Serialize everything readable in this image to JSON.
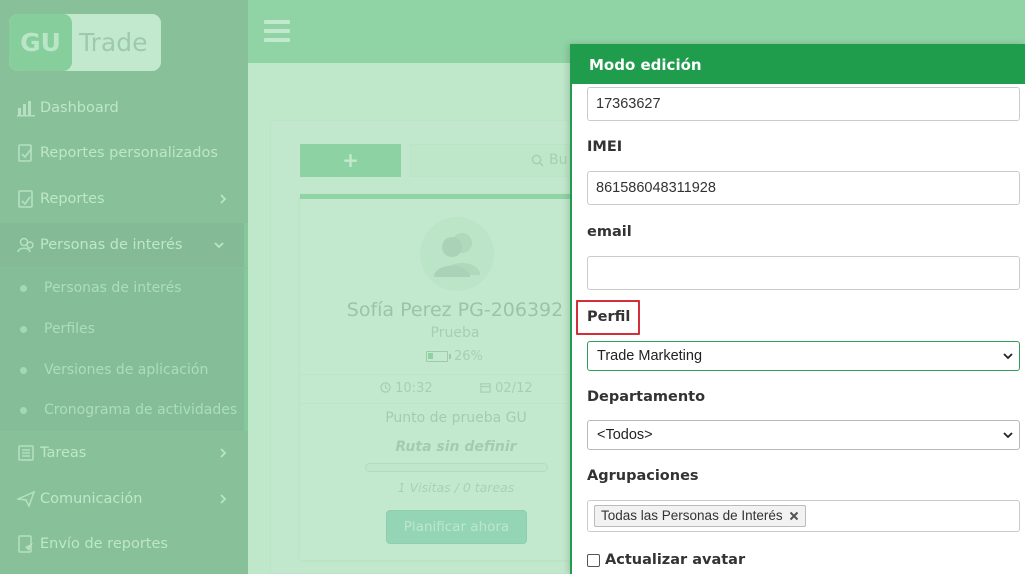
{
  "app": {
    "logo_mark": "GU",
    "logo_text": "Trade"
  },
  "sidebar": {
    "items": [
      {
        "label": "Dashboard",
        "icon": "chart-bars-icon"
      },
      {
        "label": "Reportes personalizados",
        "icon": "report-edit-icon"
      },
      {
        "label": "Reportes",
        "icon": "report-icon"
      },
      {
        "label": "Personas de interés",
        "icon": "people-icon"
      },
      {
        "label": "Tareas",
        "icon": "tasks-icon"
      },
      {
        "label": "Comunicación",
        "icon": "paper-plane-icon"
      },
      {
        "label": "Envío de reportes",
        "icon": "send-report-icon"
      }
    ],
    "submenu": [
      {
        "label": "Personas de interés"
      },
      {
        "label": "Perfiles"
      },
      {
        "label": "Versiones de aplicación"
      },
      {
        "label": "Cronograma de actividades"
      }
    ]
  },
  "main": {
    "add_label": "+",
    "search_placeholder": "Bu",
    "card": {
      "name": "Sofía Perez PG-206392",
      "subtitle": "Prueba",
      "battery": "26%",
      "battery_level": 0.26,
      "time": "10:32",
      "date": "02/12",
      "point": "Punto de prueba GU",
      "route": "Ruta sin definir",
      "route_progress": 0,
      "visits": "1 Visitas  /  0 tareas",
      "plan_button": "Planificar ahora"
    }
  },
  "modal": {
    "title": "Modo edición",
    "fields": {
      "phone_value": "17363627",
      "imei_label": "IMEI",
      "imei_value": "861586048311928",
      "email_label": "email",
      "email_value": "",
      "perfil_label": "Perfil",
      "perfil_value": "Trade Marketing",
      "departamento_label": "Departamento",
      "departamento_value": "<Todos>",
      "agrupaciones_label": "Agrupaciones",
      "agrupaciones_tag": "Todas las Personas de Interés",
      "avatar_checkbox_label": "Actualizar avatar"
    }
  },
  "colors": {
    "brand_green": "#1f9c4c",
    "highlight_red": "#d32f3a"
  }
}
